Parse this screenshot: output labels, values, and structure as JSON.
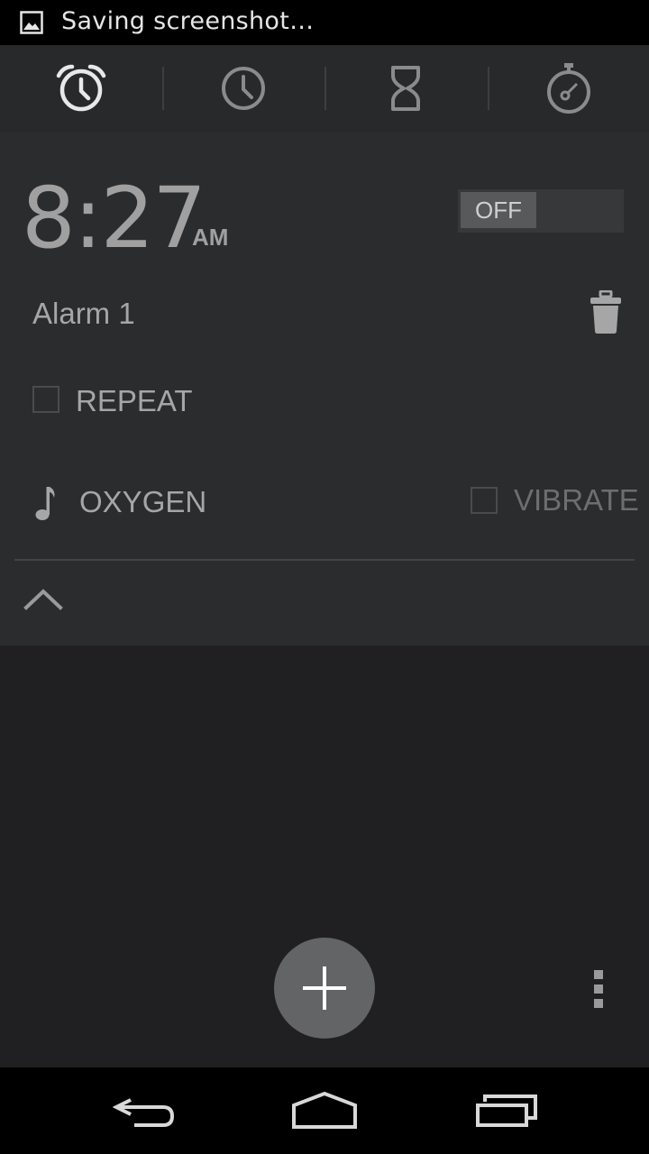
{
  "status_bar": {
    "notification_icon": "image-icon",
    "text": "Saving screenshot…"
  },
  "tabs": [
    {
      "name": "alarm",
      "icon": "alarm-clock-icon",
      "selected": true
    },
    {
      "name": "clock",
      "icon": "clock-icon",
      "selected": false
    },
    {
      "name": "timer",
      "icon": "hourglass-icon",
      "selected": false
    },
    {
      "name": "stopwatch",
      "icon": "stopwatch-icon",
      "selected": false
    }
  ],
  "alarm": {
    "time": "8:27",
    "ampm": "AM",
    "toggle_label": "OFF",
    "enabled": false,
    "label": "Alarm 1",
    "repeat_label": "REPEAT",
    "repeat_checked": false,
    "ringtone": "OXYGEN",
    "vibrate_label": "VIBRATE",
    "vibrate_checked": false
  },
  "colors": {
    "background": "#202022",
    "card": "#2b2c2e",
    "tab_bar": "#28292b",
    "fab": "#636466",
    "text": "#a6a6a6"
  },
  "icons": {
    "delete": "trash-icon",
    "ringtone": "music-note-icon",
    "collapse": "chevron-up-icon",
    "add": "plus-icon",
    "overflow": "overflow-menu-icon",
    "back": "back-icon",
    "home": "home-icon",
    "recents": "recents-icon"
  }
}
